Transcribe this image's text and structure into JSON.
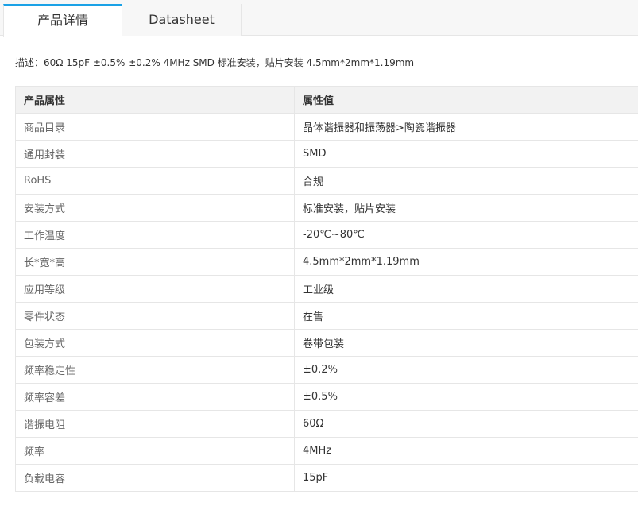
{
  "tabs": [
    {
      "label": "产品详情",
      "active": true
    },
    {
      "label": "Datasheet",
      "active": false
    }
  ],
  "description": "描述：60Ω 15pF ±0.5% ±0.2% 4MHz SMD 标准安装，贴片安装 4.5mm*2mm*1.19mm",
  "table": {
    "headers": [
      "产品属性",
      "属性值"
    ],
    "rows": [
      {
        "name": "商品目录",
        "value": "晶体谐振器和振荡器>陶瓷谐振器"
      },
      {
        "name": "通用封装",
        "value": "SMD"
      },
      {
        "name": "RoHS",
        "value": "合规"
      },
      {
        "name": "安装方式",
        "value": "标准安装，贴片安装"
      },
      {
        "name": "工作温度",
        "value": "-20℃~80℃"
      },
      {
        "name": "长*宽*高",
        "value": "4.5mm*2mm*1.19mm"
      },
      {
        "name": "应用等级",
        "value": "工业级"
      },
      {
        "name": "零件状态",
        "value": "在售"
      },
      {
        "name": "包装方式",
        "value": "卷带包装"
      },
      {
        "name": "频率稳定性",
        "value": "±0.2%"
      },
      {
        "name": "频率容差",
        "value": "±0.5%"
      },
      {
        "name": "谐振电阻",
        "value": "60Ω"
      },
      {
        "name": "频率",
        "value": "4MHz"
      },
      {
        "name": "负载电容",
        "value": "15pF"
      }
    ]
  },
  "colors": {
    "active_tab_accent": "#1aa1e6",
    "header_background": "#f2f2f2",
    "border": "#e6e6e6"
  }
}
